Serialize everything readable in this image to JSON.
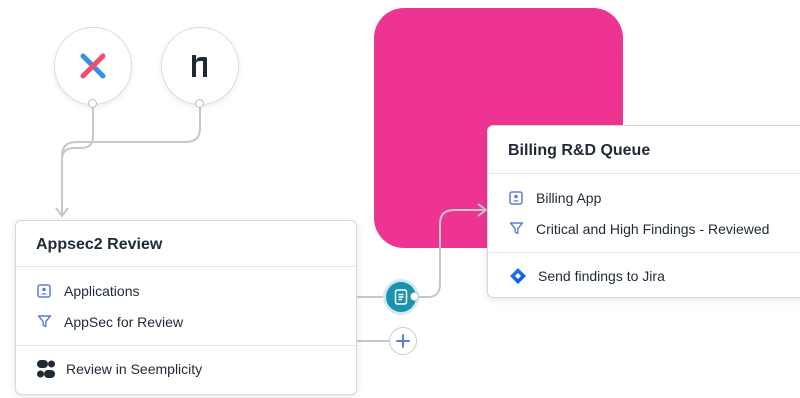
{
  "canvas": {
    "accent_color": "#ee3492",
    "teal_color": "#1b93ae",
    "link_color": "#5b7fd6"
  },
  "sources": [
    {
      "icon": "x-source-icon"
    },
    {
      "icon": "h1-source-icon"
    }
  ],
  "appsec_card": {
    "title": "Appsec2 Review",
    "scope_label": "Applications",
    "filter_label": "AppSec for Review",
    "action_label": "Review in Seemplicity"
  },
  "billing_card": {
    "title": "Billing R&D Queue",
    "scope_label": "Billing App",
    "filter_label": "Critical and High Findings - Reviewed",
    "action_label": "Send findings to Jira"
  }
}
